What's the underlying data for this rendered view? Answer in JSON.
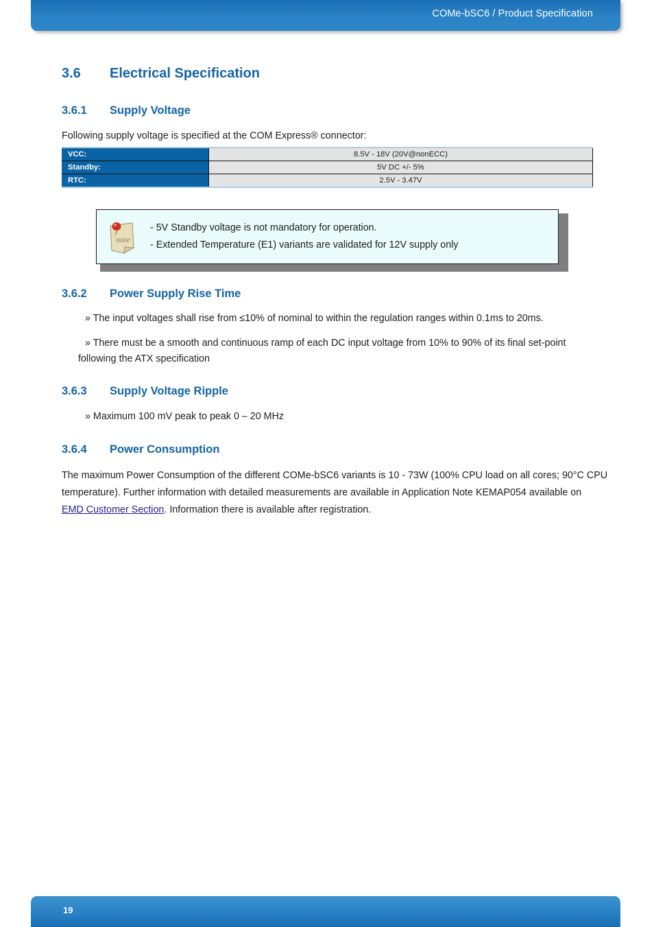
{
  "header": {
    "title": "COMe-bSC6 / Product Specification"
  },
  "footer": {
    "page_number": "19"
  },
  "sections": {
    "electrical_specification": {
      "number": "3.6",
      "title": "Electrical Specification"
    },
    "supply_voltage": {
      "number": "3.6.1",
      "title": "Supply Voltage",
      "intro": "Following supply voltage is specified at the COM Express® connector:"
    },
    "power_supply_rise_time": {
      "number": "3.6.2",
      "title": "Power Supply Rise Time",
      "bullets": [
        "» The input voltages shall rise from ≤10% of nominal to within the regulation ranges within 0.1ms to 20ms.",
        "» There must be a smooth and continuous ramp of each DC input voltage from 10% to 90% of its final set-point",
        "following the ATX specification"
      ]
    },
    "supply_voltage_ripple": {
      "number": "3.6.3",
      "title": "Supply Voltage Ripple",
      "bullets": [
        "» Maximum 100 mV peak to peak 0 – 20 MHz"
      ]
    },
    "power_consumption": {
      "number": "3.6.4",
      "title": "Power Consumption",
      "paragraph_line1": "The maximum Power Consumption of the different COMe-bSC6 variants is 10 - 73W (100% CPU load on all cores; 90°C CPU",
      "paragraph_line2": "temperature). Further information with detailed measurements are available in Application Note KEMAP054 available on",
      "paragraph_line3_link": "EMD Customer Section",
      "paragraph_line3_rest": ". Information there is available after registration."
    }
  },
  "supply_voltage_table": {
    "rows": [
      {
        "key": "VCC:",
        "value": "8.5V - 18V (20V@nonECC)"
      },
      {
        "key": "Standby:",
        "value": "5V DC +/- 5%"
      },
      {
        "key": "RTC:",
        "value": "2.5V - 3.47V"
      }
    ]
  },
  "note_box": {
    "icon": "sticky-note-icon",
    "icon_label": "note",
    "lines": [
      "- 5V Standby voltage is not mandatory for operation.",
      "- Extended Temperature (E1) variants are validated for 12V supply only"
    ]
  },
  "colors": {
    "brand_blue": "#1464a5",
    "header_bar_blue": "#2b82c4",
    "table_key_blue": "#0a63a4",
    "table_value_gray": "#e4e4e4",
    "note_background": "#e9fbfb",
    "link_blue": "#1f1f8f"
  }
}
